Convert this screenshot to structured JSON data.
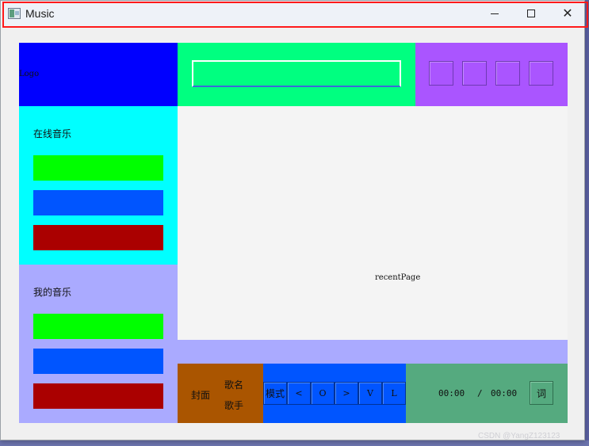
{
  "window": {
    "title": "Music",
    "controls": {
      "minimize": "",
      "maximize": "",
      "close": "✕"
    }
  },
  "header": {
    "logo_text": "Logo",
    "search": {
      "value": "",
      "placeholder": ""
    },
    "toolbar_buttons": [
      "",
      "",
      "",
      ""
    ]
  },
  "sidebar": {
    "online_section": {
      "label": "在线音乐",
      "buttons": [
        "",
        "",
        ""
      ]
    },
    "my_section": {
      "label": "我的音乐",
      "buttons": [
        "",
        "",
        ""
      ]
    }
  },
  "main": {
    "page_label": "recentPage"
  },
  "player": {
    "cover_label": "封面",
    "song_label": "歌名",
    "singer_label": "歌手",
    "controls": {
      "mode": "模式",
      "prev": "<",
      "play": "O",
      "next": ">",
      "volume": "V",
      "list": "L"
    },
    "time": {
      "current": "00:00",
      "separator": "/",
      "total": "00:00"
    },
    "lyric_button": "词"
  },
  "watermark": "CSDN @YangZ123123",
  "colors": {
    "logo_bg": "#0000ff",
    "search_bg": "#00ff80",
    "toolbar_bg": "#aa55ff",
    "online_bg": "#00ffff",
    "mine_bg": "#aaaaff",
    "content_bg": "#f4f4f4",
    "cover_bg": "#aa5500",
    "controls_bg": "#0055ff",
    "time_bg": "#55aa7f",
    "nav_green": "#00ff00",
    "nav_blue": "#0055ff",
    "nav_red": "#aa0000",
    "title_highlight": "#ff1a1a"
  }
}
